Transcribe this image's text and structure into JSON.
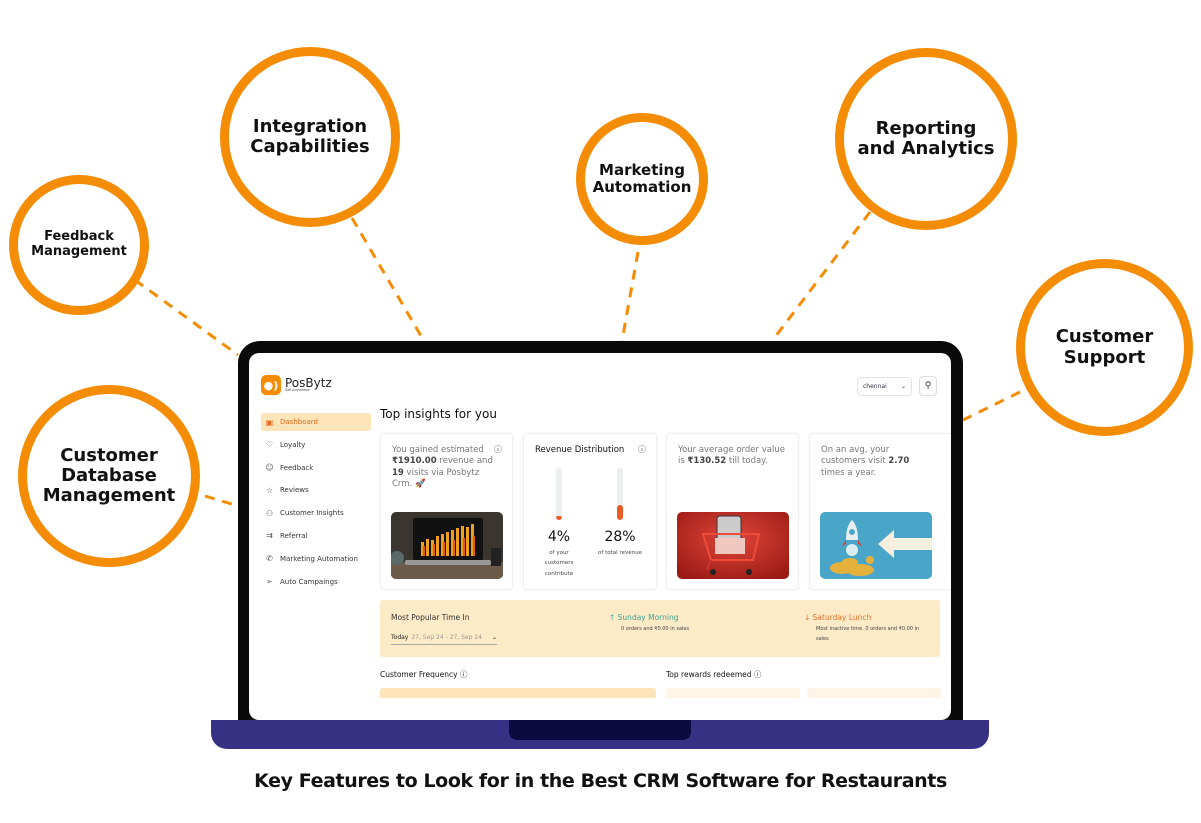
{
  "caption": "Key Features to Look for in the Best CRM Software for Restaurants",
  "accent_color": "#f48c06",
  "features": [
    {
      "id": "feedback",
      "lines": [
        "Feedback",
        "Management"
      ]
    },
    {
      "id": "integration",
      "lines": [
        "Integration",
        "Capabilities"
      ]
    },
    {
      "id": "marketing",
      "lines": [
        "Marketing",
        "Automation"
      ]
    },
    {
      "id": "reporting",
      "lines": [
        "Reporting",
        "and Analytics"
      ]
    },
    {
      "id": "support",
      "lines": [
        "Customer",
        "Support"
      ]
    },
    {
      "id": "database",
      "lines": [
        "Customer",
        "Database",
        "Management"
      ]
    }
  ],
  "app": {
    "brand": "PosBytz",
    "tagline": "Sell anywhere",
    "location_select": "chennai",
    "sidebar": [
      {
        "label": "Dashboard",
        "icon": "dashboard-icon",
        "glyph": "▣",
        "active": true
      },
      {
        "label": "Loyalty",
        "icon": "heart-icon",
        "glyph": "♡"
      },
      {
        "label": "Feedback",
        "icon": "feedback-icon",
        "glyph": "☺"
      },
      {
        "label": "Reviews",
        "icon": "star-icon",
        "glyph": "☆"
      },
      {
        "label": "Customer Insights",
        "icon": "users-icon",
        "glyph": "⚇"
      },
      {
        "label": "Referral",
        "icon": "referral-icon",
        "glyph": "⇉"
      },
      {
        "label": "Marketing Automation",
        "icon": "megaphone-icon",
        "glyph": "✆"
      },
      {
        "label": "Auto Campaings",
        "icon": "send-icon",
        "glyph": "➢"
      }
    ],
    "main_title": "Top insights for you",
    "insights": {
      "gained": {
        "prefix": "You gained estimated ",
        "revenue": "₹1910.00",
        "mid": " revenue and ",
        "visits": "19",
        "suffix": " visits via Posbytz Crm. 🚀"
      },
      "revenue_distribution": {
        "title": "Revenue Distribution",
        "customers_pct": 4,
        "customers_label": "4%",
        "customers_sub": "of your customers contribute",
        "revenue_pct": 28,
        "revenue_label": "28%",
        "revenue_sub": "of total revenue"
      },
      "avg_order": {
        "prefix": "Your average order value is ",
        "value": "₹130.52",
        "suffix": " till today."
      },
      "visit_freq": {
        "prefix": "On an avg, your customers visit ",
        "value": "2.70",
        "suffix": " times a year."
      }
    },
    "popular_time": {
      "title": "Most Popular Time In",
      "period": "Today",
      "range": "27, Sep 24 - 27, Sep 24",
      "peak_label": "Sunday Morning",
      "peak_sub": "0 orders and ₹0.00 in sales",
      "low_label": "Saturday Lunch",
      "low_sub": "Most inactive time. 0 orders and ₹0.00 in sales"
    },
    "sections": {
      "customer_frequency": "Customer Frequency",
      "top_rewards": "Top rewards redeemed"
    }
  }
}
